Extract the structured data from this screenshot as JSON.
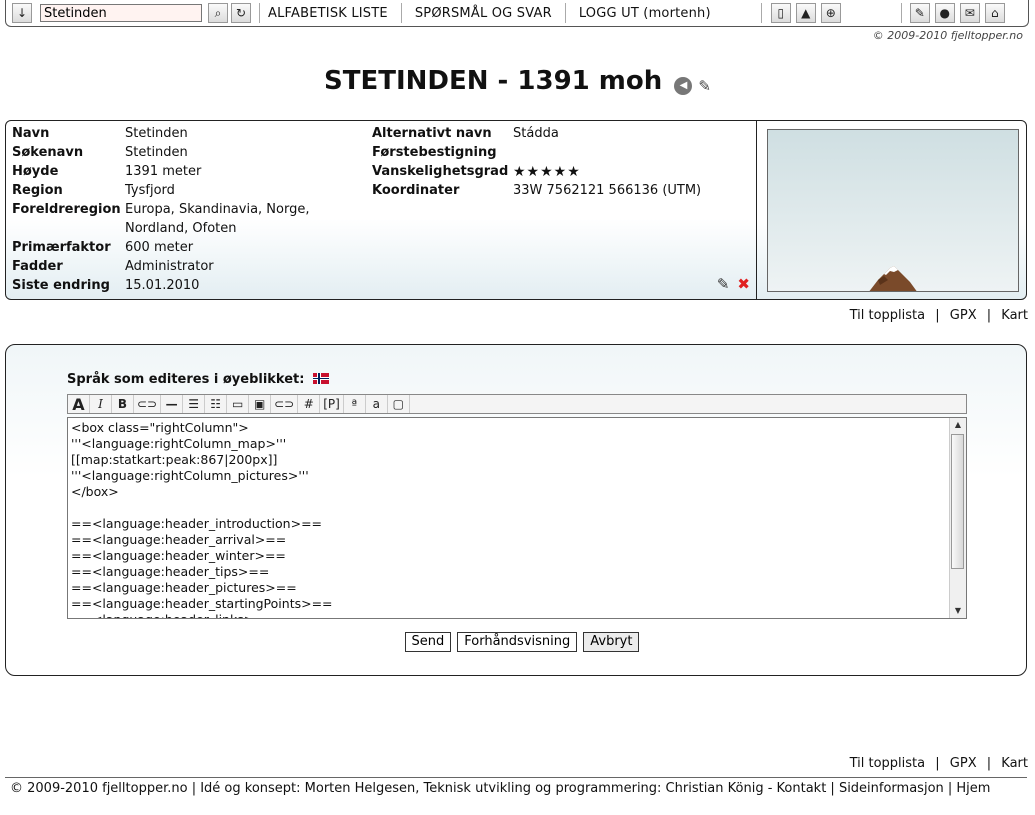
{
  "topbar": {
    "search_value": "Stetinden",
    "menu": [
      "ALFABETISK LISTE",
      "SPØRSMÅL OG SVAR",
      "LOGG UT (mortenh)"
    ],
    "copyright": "© 2009-2010 fjelltopper.no"
  },
  "title": "STETINDEN - 1391 moh",
  "info": {
    "left": [
      {
        "label": "Navn",
        "value": "Stetinden"
      },
      {
        "label": "Søkenavn",
        "value": "Stetinden"
      },
      {
        "label": "Høyde",
        "value": "1391 meter"
      },
      {
        "label": "Region",
        "value": "Tysfjord"
      },
      {
        "label": "Foreldreregion",
        "value": "Europa, Skandinavia, Norge,"
      },
      {
        "label": "",
        "value": "Nordland, Ofoten"
      },
      {
        "label": "Primærfaktor",
        "value": "600 meter"
      },
      {
        "label": "Fadder",
        "value": "Administrator"
      },
      {
        "label": "Siste endring",
        "value": "15.01.2010"
      }
    ],
    "right": [
      {
        "label": "Alternativt navn",
        "value": "Stádda"
      },
      {
        "label": "Førstebestigning",
        "value": ""
      },
      {
        "label": "Vanskelighetsgrad",
        "value": "★★★★★"
      },
      {
        "label": "Koordinater",
        "value": "33W 7562121 566136 (UTM)"
      }
    ],
    "difficulty_stars": 5
  },
  "links": {
    "toplist": "Til topplista",
    "gpx": "GPX",
    "map": "Kart",
    "sep": "|"
  },
  "editor": {
    "language_label": "Språk som editeres i øyeblikket:",
    "toolbar": [
      "A",
      "I",
      "B",
      "⊂⊃",
      "—",
      "☰",
      "☷",
      "▭",
      "▣",
      "⊂⊃",
      "#",
      "[P]",
      "ª",
      "a",
      "▢"
    ],
    "content": "<box class=\"rightColumn\">\n'''<language:rightColumn_map>'''\n[[map:statkart:peak:867|200px]]\n'''<language:rightColumn_pictures>'''\n</box>\n\n==<language:header_introduction>==\n==<language:header_arrival>==\n==<language:header_winter>==\n==<language:header_tips>==\n==<language:header_pictures>==\n==<language:header_startingPoints>==\n==<language:header_links>=="
  },
  "buttons": {
    "send": "Send",
    "preview": "Forhåndsvisning",
    "cancel": "Avbryt"
  },
  "footer": "© 2009-2010 fjelltopper.no | Idé og konsept: Morten Helgesen, Teknisk utvikling og programmering: Christian König  -  Kontakt | Sideinformasjon | Hjem"
}
